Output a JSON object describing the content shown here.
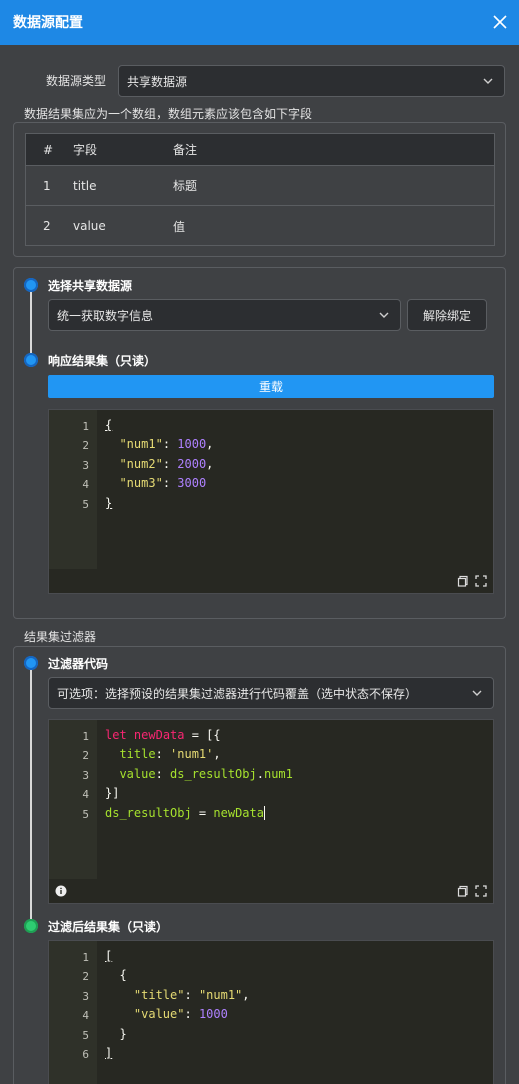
{
  "dialog": {
    "title": "数据源配置"
  },
  "source_type": {
    "label": "数据源类型",
    "value": "共享数据源"
  },
  "result_hint": "数据结果集应为一个数组，数组元素应该包含如下字段",
  "fields_table": {
    "headers": [
      "#",
      "字段",
      "备注"
    ],
    "rows": [
      {
        "index": "1",
        "field": "title",
        "note": "标题"
      },
      {
        "index": "2",
        "field": "value",
        "note": "值"
      }
    ]
  },
  "shared_source": {
    "step_label": "选择共享数据源",
    "selected": "统一获取数字信息",
    "unbind_label": "解除绑定"
  },
  "response": {
    "step_label": "响应结果集（只读）",
    "reload_label": "重载",
    "lines": [
      "1",
      "2",
      "3",
      "4",
      "5"
    ]
  },
  "filter_section_label": "结果集过滤器",
  "filter_code": {
    "step_label": "过滤器代码",
    "preset_placeholder": "可选项：选择预设的结果集过滤器进行代码覆盖（选中状态不保存）",
    "lines": [
      "1",
      "2",
      "3",
      "4",
      "5"
    ]
  },
  "filtered": {
    "step_label": "过滤后结果集（只读）",
    "lines": [
      "1",
      "2",
      "3",
      "4",
      "5",
      "6"
    ]
  },
  "colors": {
    "accent": "#2196f3",
    "success": "#2ecc71",
    "warning": "#f5c542"
  },
  "icons": [
    "close-icon",
    "chevron-down-icon",
    "copy-icon",
    "fullscreen-icon",
    "warning-icon",
    "info-icon"
  ]
}
